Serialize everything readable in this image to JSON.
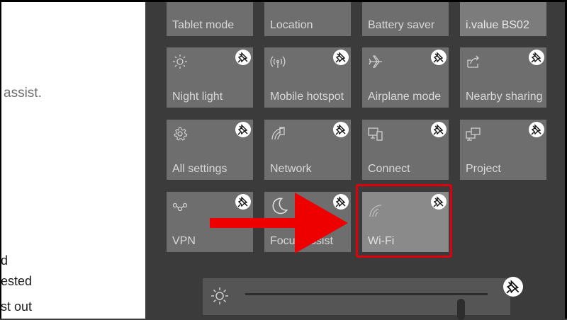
{
  "settings_text": {
    "line_assist": "assist.",
    "line_d": "d",
    "line_ested": "ested",
    "line_st_out": "st out"
  },
  "tiles": [
    {
      "label": "Tablet mode",
      "icon": "tablet-mode-icon"
    },
    {
      "label": "Location",
      "icon": "location-icon"
    },
    {
      "label": "Battery saver",
      "icon": "battery-saver-icon"
    },
    {
      "label": "i.value BS02",
      "icon": "bluetooth-device-icon"
    },
    {
      "label": "Night light",
      "icon": "sun-icon"
    },
    {
      "label": "Mobile hotspot",
      "icon": "hotspot-icon"
    },
    {
      "label": "Airplane mode",
      "icon": "airplane-icon"
    },
    {
      "label": "Nearby sharing",
      "icon": "share-icon"
    },
    {
      "label": "All settings",
      "icon": "gear-icon"
    },
    {
      "label": "Network",
      "icon": "network-icon"
    },
    {
      "label": "Connect",
      "icon": "connect-icon"
    },
    {
      "label": "Project",
      "icon": "project-icon"
    },
    {
      "label": "VPN",
      "icon": "vpn-icon"
    },
    {
      "label": "Focus assist",
      "icon": "moon-icon"
    },
    {
      "label": "Wi-Fi",
      "icon": "wifi-icon"
    }
  ],
  "brightness": {
    "level": 0.89,
    "icon": "sun-icon"
  },
  "colors": {
    "panel_bg": "#3b3b3b",
    "tile_bg": "#6e6e6e",
    "highlight": "#e0000d"
  }
}
